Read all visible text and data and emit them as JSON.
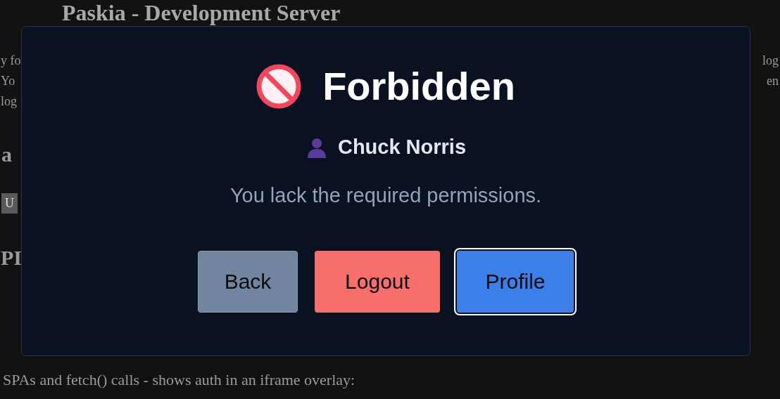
{
  "background": {
    "title": "Paskia - Development Server",
    "left_fragments": [
      "y fo",
      "Yo",
      "log"
    ],
    "right_fragments": [
      "log",
      "en"
    ],
    "heading_fragment": "a",
    "button_fragment": "U",
    "heading2_fragment": "PI",
    "footer_text": "SPAs and fetch() calls - shows auth in an iframe overlay:"
  },
  "dialog": {
    "title": "Forbidden",
    "user": "Chuck Norris",
    "message": "You lack the required permissions.",
    "buttons": [
      {
        "label": "Back",
        "kind": "neutral",
        "focused": false
      },
      {
        "label": "Logout",
        "kind": "danger",
        "focused": false
      },
      {
        "label": "Profile",
        "kind": "primary",
        "focused": true
      }
    ]
  }
}
